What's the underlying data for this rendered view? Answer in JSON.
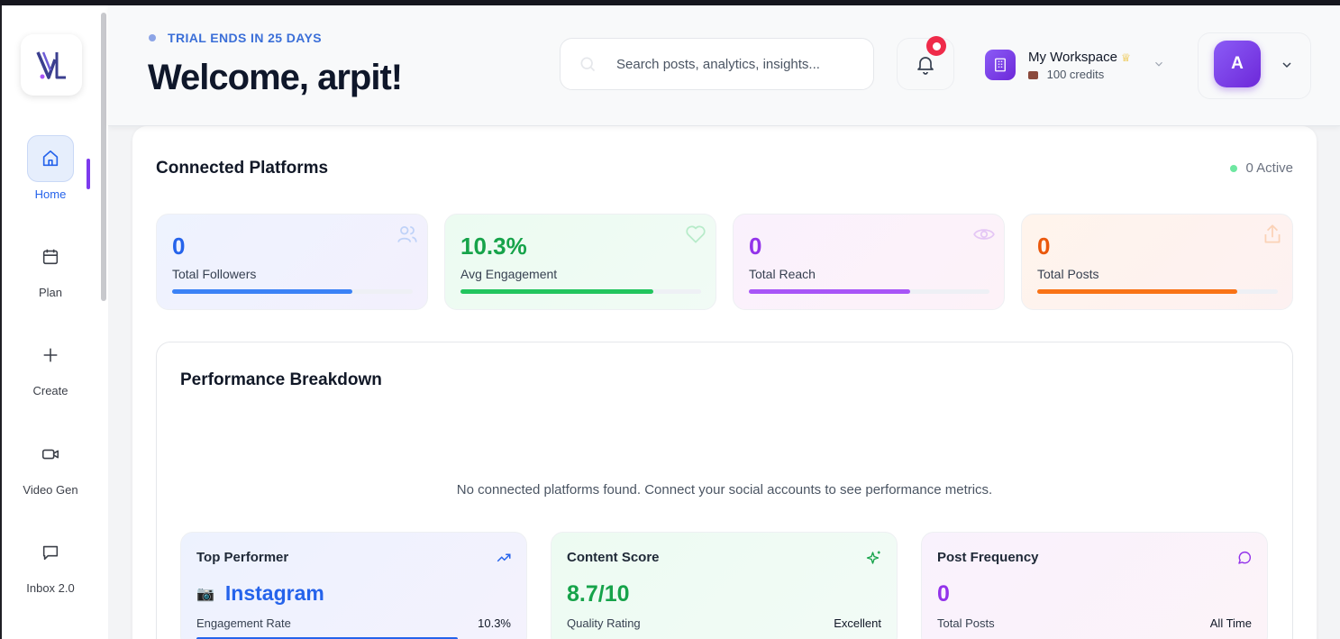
{
  "sidebar": {
    "items": [
      {
        "label": "Home",
        "icon": "home-icon"
      },
      {
        "label": "Plan",
        "icon": "calendar-icon"
      },
      {
        "label": "Create",
        "icon": "plus-icon"
      },
      {
        "label": "Video Gen",
        "icon": "video-icon"
      },
      {
        "label": "Inbox 2.0",
        "icon": "chat-icon"
      }
    ]
  },
  "header": {
    "trial": "TRIAL ENDS IN 25 DAYS",
    "welcome": "Welcome, arpit!",
    "search_placeholder": "Search posts, analytics, insights...",
    "workspace_name": "My Workspace",
    "workspace_credits": "100 credits",
    "avatar_initial": "A"
  },
  "connected": {
    "title": "Connected Platforms",
    "status": "0 Active",
    "stats": [
      {
        "value": "0",
        "label": "Total Followers",
        "color": "#3b82f6",
        "progress": 0.75
      },
      {
        "value": "10.3%",
        "label": "Avg Engagement",
        "color": "#22c55e",
        "progress": 0.8
      },
      {
        "value": "0",
        "label": "Total Reach",
        "color": "#a855f7",
        "progress": 0.67
      },
      {
        "value": "0",
        "label": "Total Posts",
        "color": "#f97316",
        "progress": 0.83
      }
    ]
  },
  "performance": {
    "title": "Performance Breakdown",
    "empty_message": "No connected platforms found. Connect your social accounts to see performance metrics.",
    "cards": [
      {
        "title": "Top Performer",
        "value": "Instagram",
        "value_icon": "📷",
        "sub": "Engagement Rate",
        "right": "10.3%"
      },
      {
        "title": "Content Score",
        "value": "8.7/10",
        "sub": "Quality Rating",
        "right": "Excellent"
      },
      {
        "title": "Post Frequency",
        "value": "0",
        "sub": "Total Posts",
        "right": "All Time"
      }
    ]
  }
}
